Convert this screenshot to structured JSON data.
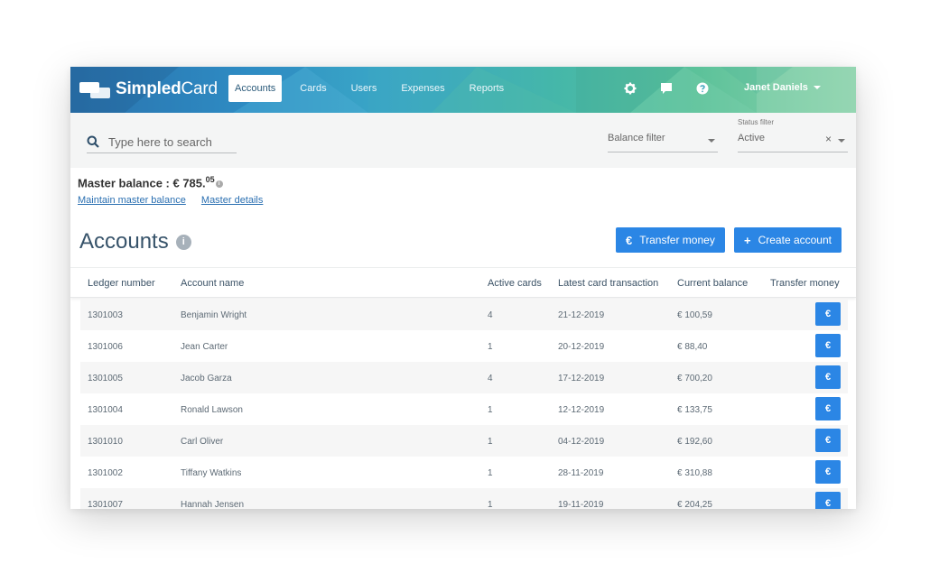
{
  "app": {
    "logo_text_bold": "Simpled",
    "logo_text_light": "Card"
  },
  "nav": {
    "items": [
      {
        "label": "Accounts",
        "active": true
      },
      {
        "label": "Cards"
      },
      {
        "label": "Users"
      },
      {
        "label": "Expenses"
      },
      {
        "label": "Reports"
      }
    ]
  },
  "header_icons": [
    "gear-icon",
    "chat-icon",
    "help-icon"
  ],
  "user": {
    "name": "Janet Daniels"
  },
  "filters": {
    "search_placeholder": "Type here to search",
    "balance_filter": {
      "value": "Balance filter"
    },
    "status_filter": {
      "label": "Status filter",
      "value": "Active",
      "clear": "×"
    }
  },
  "master": {
    "label": "Master balance : € 785.",
    "cents": "05",
    "links": [
      "Maintain master balance",
      "Master details"
    ]
  },
  "accounts": {
    "title": "Accounts",
    "info_icon": "i",
    "transfer_label": "Transfer money",
    "transfer_icon": "€",
    "create_label": "Create account",
    "create_icon": "+"
  },
  "table": {
    "headers": [
      "Ledger number",
      "Account name",
      "Active cards",
      "Latest card transaction",
      "Current balance",
      "Transfer money"
    ],
    "row_button": "€",
    "rows": [
      [
        "1301003",
        "Benjamin Wright",
        "4",
        "21-12-2019",
        "€ 100,59"
      ],
      [
        "1301006",
        "Jean Carter",
        "1",
        "20-12-2019",
        "€ 88,40"
      ],
      [
        "1301005",
        "Jacob Garza",
        "4",
        "17-12-2019",
        "€ 700,20"
      ],
      [
        "1301004",
        "Ronald Lawson",
        "1",
        "12-12-2019",
        "€ 133,75"
      ],
      [
        "1301010",
        "Carl Oliver",
        "1",
        "04-12-2019",
        "€ 192,60"
      ],
      [
        "1301002",
        "Tiffany Watkins",
        "1",
        "28-11-2019",
        "€ 310,88"
      ],
      [
        "1301007",
        "Hannah Jensen",
        "1",
        "19-11-2019",
        "€ 204,25"
      ]
    ]
  },
  "colors": {
    "accent": "#2b86e5",
    "link": "#2a6fb1",
    "title": "#37536a"
  }
}
